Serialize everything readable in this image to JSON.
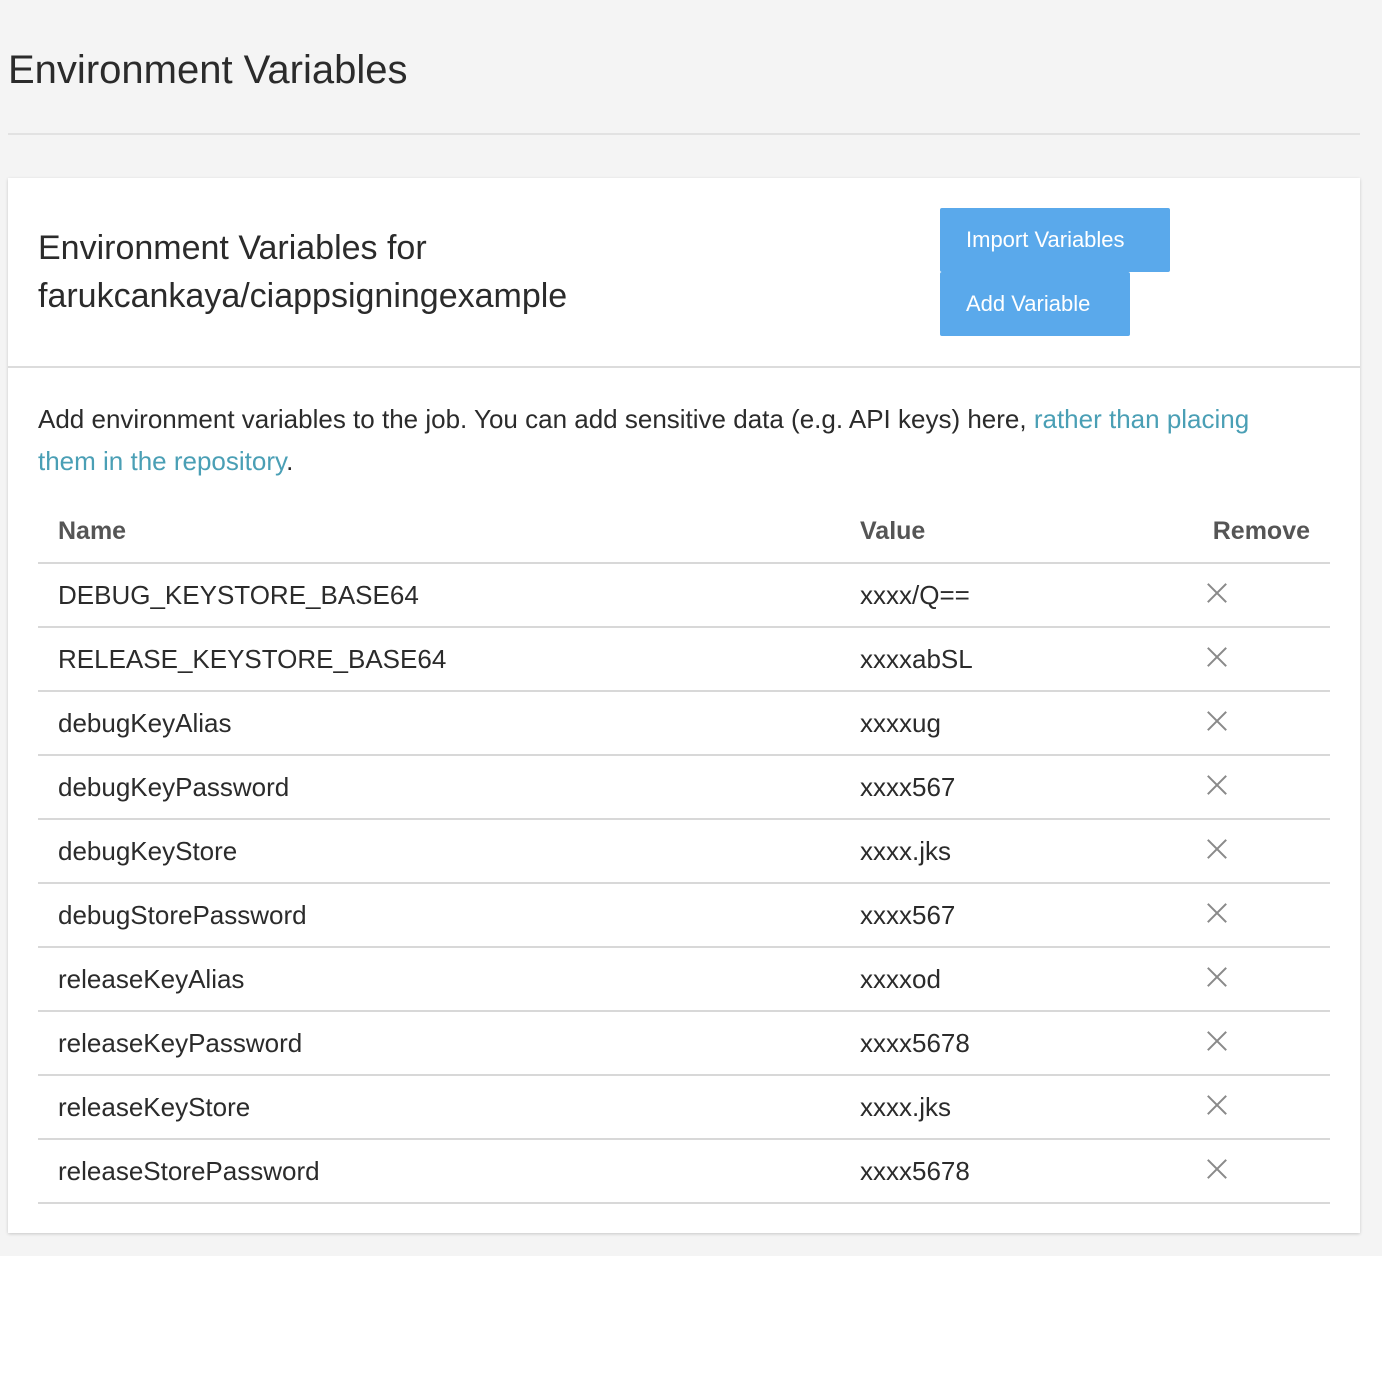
{
  "page": {
    "title": "Environment Variables"
  },
  "card": {
    "title_line1": "Environment Variables for",
    "title_line2": "farukcankaya/ciappsigningexample",
    "import_label": "Import Variables",
    "add_label": "Add Variable"
  },
  "description": {
    "text": "Add environment variables to the job. You can add sensitive data (e.g. API keys) here, ",
    "link_text": "rather than placing them in the repository",
    "suffix": "."
  },
  "table": {
    "headers": {
      "name": "Name",
      "value": "Value",
      "remove": "Remove"
    },
    "rows": [
      {
        "name": "DEBUG_KEYSTORE_BASE64",
        "value": "xxxx/Q=="
      },
      {
        "name": "RELEASE_KEYSTORE_BASE64",
        "value": "xxxxabSL"
      },
      {
        "name": "debugKeyAlias",
        "value": "xxxxug"
      },
      {
        "name": "debugKeyPassword",
        "value": "xxxx567"
      },
      {
        "name": "debugKeyStore",
        "value": "xxxx.jks"
      },
      {
        "name": "debugStorePassword",
        "value": "xxxx567"
      },
      {
        "name": "releaseKeyAlias",
        "value": "xxxxod"
      },
      {
        "name": "releaseKeyPassword",
        "value": "xxxx5678"
      },
      {
        "name": "releaseKeyStore",
        "value": "xxxx.jks"
      },
      {
        "name": "releaseStorePassword",
        "value": "xxxx5678"
      }
    ]
  },
  "icons": {
    "remove": "close-icon"
  },
  "colors": {
    "button": "#5aa9eb",
    "link": "#4a9fb5",
    "page_bg": "#f4f4f4"
  }
}
